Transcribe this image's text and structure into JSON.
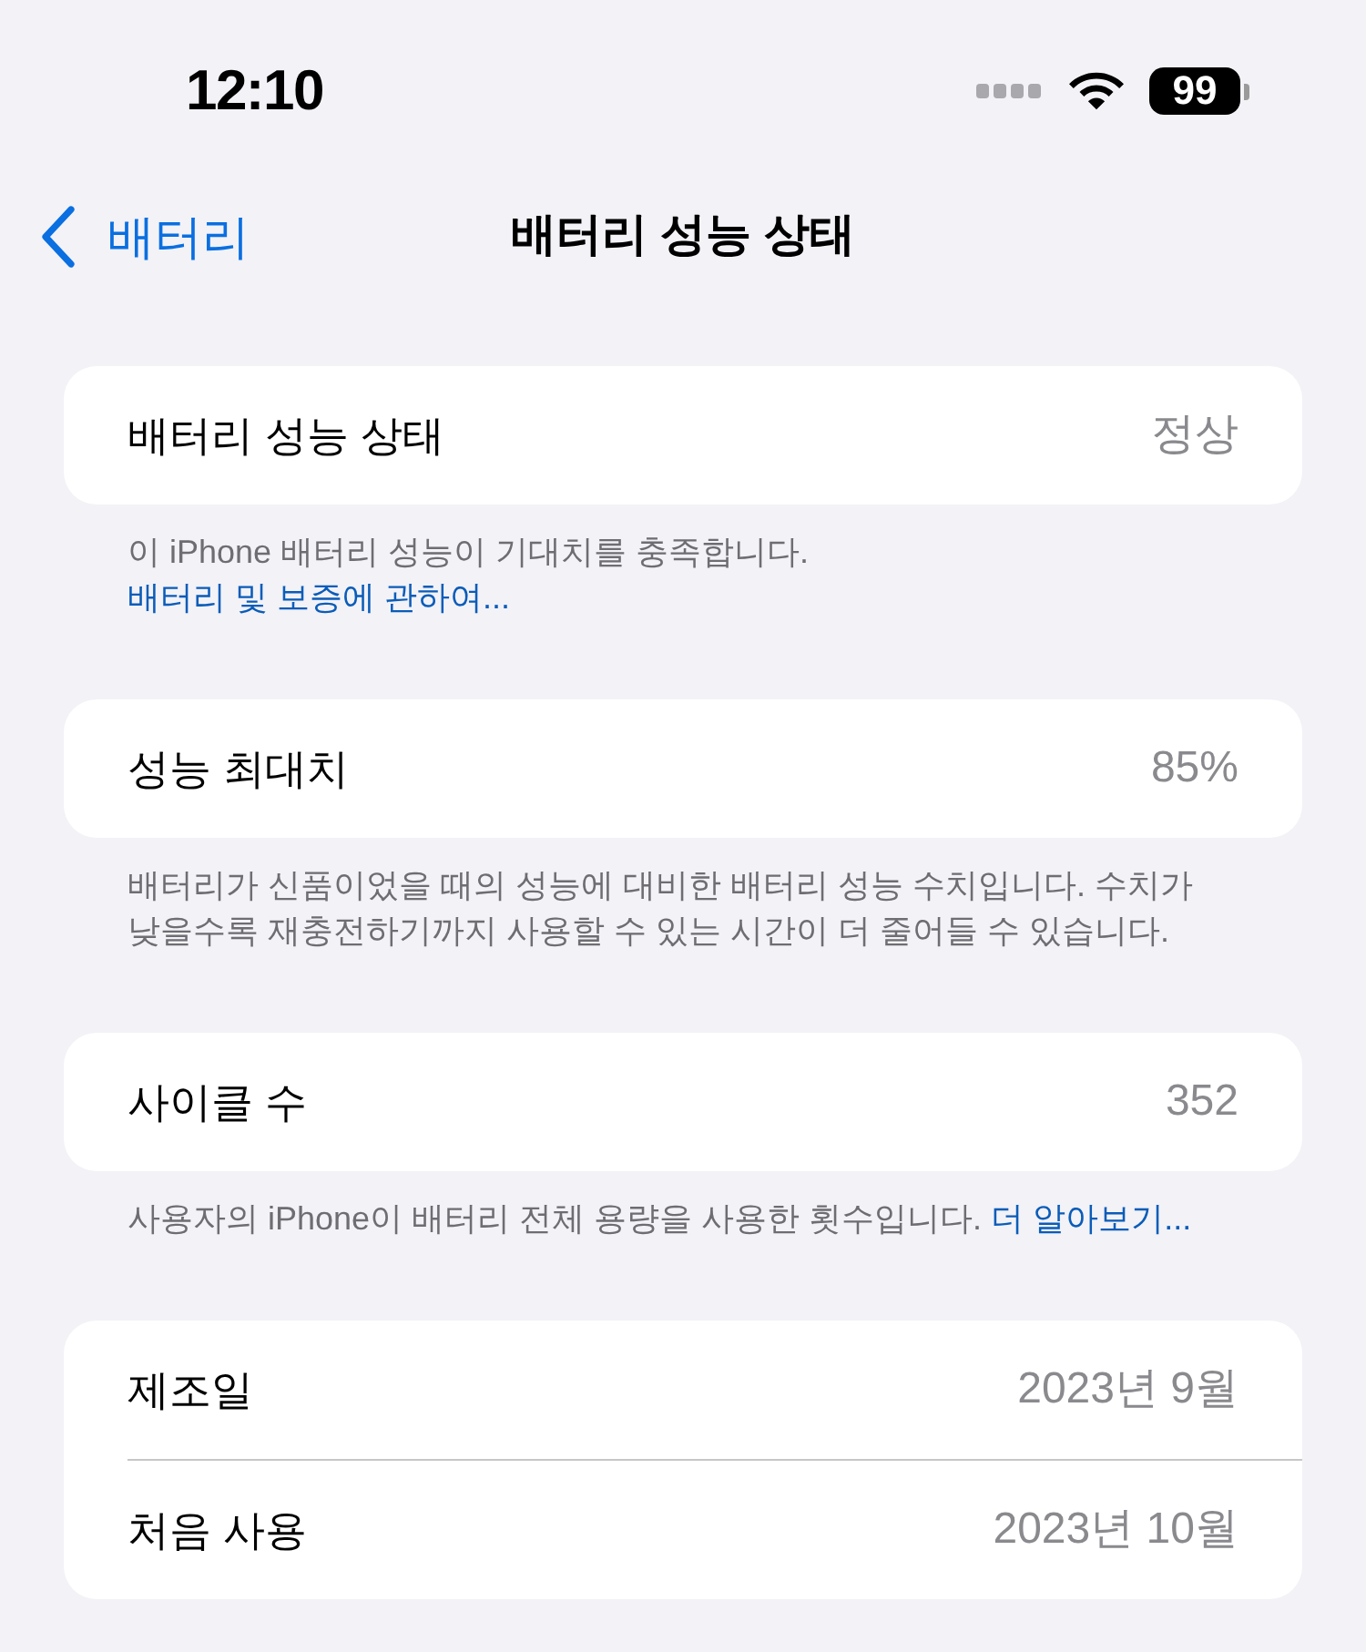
{
  "status_bar": {
    "time": "12:10",
    "battery": "99"
  },
  "nav": {
    "back": "배터리",
    "title": "배터리 성능 상태"
  },
  "groups": [
    {
      "rows": [
        {
          "label": "배터리 성능 상태",
          "value": "정상"
        }
      ],
      "footer": {
        "text": "이 iPhone 배터리 성능이 기대치를 충족합니다.",
        "link": "배터리 및 보증에 관하여..."
      }
    },
    {
      "rows": [
        {
          "label": "성능 최대치",
          "value": "85%"
        }
      ],
      "footer": {
        "text": "배터리가 신품이었을 때의 성능에 대비한 배터리 성능 수치입니다. 수치가 낮을수록 재충전하기까지 사용할 수 있는 시간이 더 줄어들 수 있습니다."
      }
    },
    {
      "rows": [
        {
          "label": "사이클 수",
          "value": "352"
        }
      ],
      "footer": {
        "text": "사용자의 iPhone이 배터리 전체 용량을 사용한 횟수입니다.",
        "link": "더 알아보기..."
      }
    },
    {
      "rows": [
        {
          "label": "제조일",
          "value": "2023년 9월"
        },
        {
          "label": "처음 사용",
          "value": "2023년 10월"
        }
      ]
    }
  ]
}
